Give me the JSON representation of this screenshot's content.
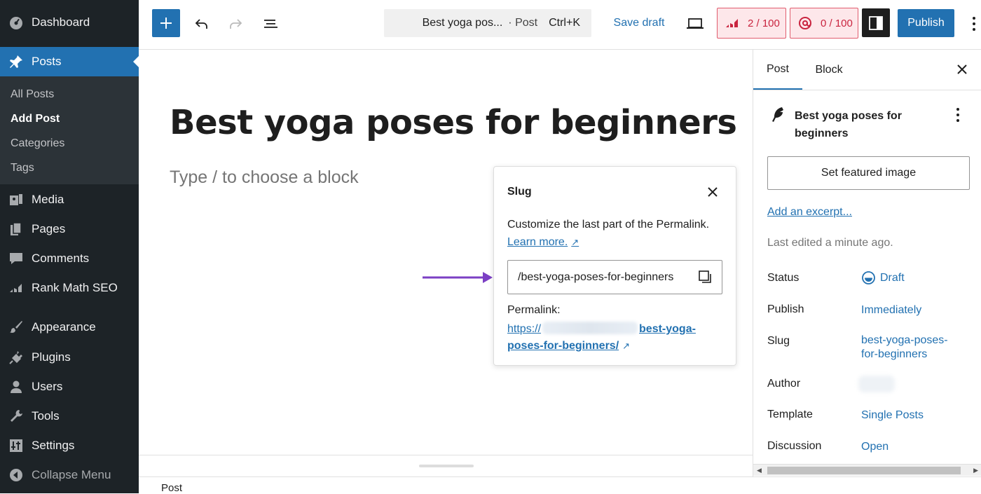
{
  "admin_menu": {
    "dashboard": "Dashboard",
    "posts": "Posts",
    "submenu": [
      "All Posts",
      "Add Post",
      "Categories",
      "Tags"
    ],
    "media": "Media",
    "pages": "Pages",
    "comments": "Comments",
    "rankmath": "Rank Math SEO",
    "appearance": "Appearance",
    "plugins": "Plugins",
    "users": "Users",
    "tools": "Tools",
    "settings": "Settings",
    "collapse": "Collapse Menu"
  },
  "toolbar": {
    "command_title": "Best yoga pos...",
    "command_type": "· Post",
    "command_shortcut": "Ctrl+K",
    "save_draft": "Save draft",
    "seo_score": "2 / 100",
    "content_score": "0 / 100",
    "publish": "Publish"
  },
  "editor": {
    "post_title": "Best yoga poses for beginners",
    "block_placeholder": "Type / to choose a block",
    "breadcrumb": "Post"
  },
  "slug_popover": {
    "heading": "Slug",
    "description": "Customize the last part of the Permalink.",
    "learn_more": "Learn more.",
    "slug_value": "/best-yoga-poses-for-beginners",
    "permalink_label": "Permalink:",
    "permalink_prefix": "https://",
    "permalink_slug_1": "best-yoga-",
    "permalink_slug_2": "poses-for-beginners/"
  },
  "sidebar": {
    "tab_post": "Post",
    "tab_block": "Block",
    "doc_title": "Best yoga poses for beginners",
    "featured_image": "Set featured image",
    "add_excerpt": "Add an excerpt...",
    "last_edited": "Last edited a minute ago.",
    "rows": {
      "status_label": "Status",
      "status_value": "Draft",
      "publish_label": "Publish",
      "publish_value": "Immediately",
      "slug_label": "Slug",
      "slug_value_1": "best-yoga-poses-",
      "slug_value_2": "for-beginners",
      "author_label": "Author",
      "template_label": "Template",
      "template_value": "Single Posts",
      "discussion_label": "Discussion",
      "discussion_value": "Open"
    }
  },
  "colors": {
    "accent": "#2271b1",
    "admin_bg": "#1d2327",
    "score_bad": "#c9243f",
    "arrow": "#7b3fc4"
  }
}
